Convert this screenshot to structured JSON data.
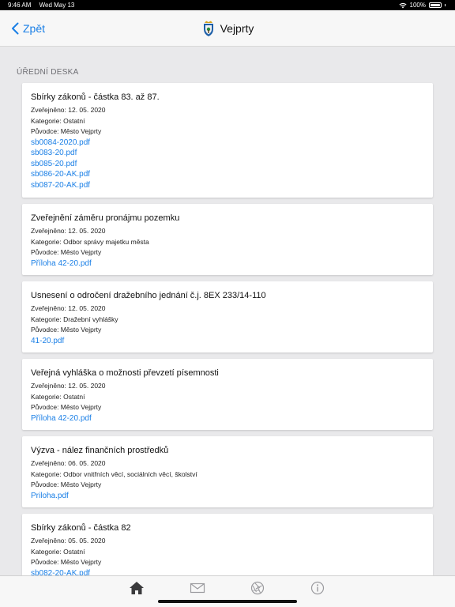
{
  "status_bar": {
    "time": "9:46 AM",
    "date": "Wed May 13",
    "battery": "100%"
  },
  "nav": {
    "back_label": "Zpět",
    "title": "Vejprty"
  },
  "section_title": "ÚŘEDNÍ DESKA",
  "cards": [
    {
      "title": "Sbírky zákonů - částka 83. až 87.",
      "published": "Zveřejněno: 12. 05. 2020",
      "category": "Kategorie: Ostatní",
      "originator": "Původce: Město Vejprty",
      "links": [
        "sb0084-2020.pdf",
        "sb083-20.pdf",
        "sb085-20.pdf",
        "sb086-20-AK.pdf",
        "sb087-20-AK.pdf"
      ]
    },
    {
      "title": "Zveřejnění záměru pronájmu pozemku",
      "published": "Zveřejněno: 12. 05. 2020",
      "category": "Kategorie: Odbor správy majetku města",
      "originator": "Původce: Město Vejprty",
      "links": [
        "Příloha 42-20.pdf"
      ]
    },
    {
      "title": "Usnesení o odročení dražebního jednání č.j. 8EX 233/14-110",
      "published": "Zveřejněno: 12. 05. 2020",
      "category": "Kategorie: Dražební vyhlášky",
      "originator": "Původce: Město Vejprty",
      "links": [
        "41-20.pdf"
      ]
    },
    {
      "title": "Veřejná vyhláška o možnosti převzetí písemnosti",
      "published": "Zveřejněno: 12. 05. 2020",
      "category": "Kategorie: Ostatní",
      "originator": "Původce: Město Vejprty",
      "links": [
        "Příloha 42-20.pdf"
      ]
    },
    {
      "title": "Výzva - nález finančních prostředků",
      "published": "Zveřejněno: 06. 05. 2020",
      "category": "Kategorie: Odbor vnitřních věcí, sociálních věcí, školství",
      "originator": "Původce: Město Vejprty",
      "links": [
        "Priloha.pdf"
      ]
    },
    {
      "title": "Sbírky zákonů - částka 82",
      "published": "Zveřejněno: 05. 05. 2020",
      "category": "Kategorie: Ostatní",
      "originator": "Původce: Město Vejprty",
      "links": [
        "sb082-20-AK.pdf"
      ]
    }
  ],
  "tabs": [
    {
      "icon": "home-icon",
      "active": true
    },
    {
      "icon": "mail-icon",
      "active": false
    },
    {
      "icon": "aperture-icon",
      "active": false
    },
    {
      "icon": "info-icon",
      "active": false
    }
  ],
  "colors": {
    "accent": "#1a7fe6",
    "background": "#e9e9eb",
    "active_tab": "#3a3a3c",
    "inactive_tab": "#9b9b9f"
  }
}
